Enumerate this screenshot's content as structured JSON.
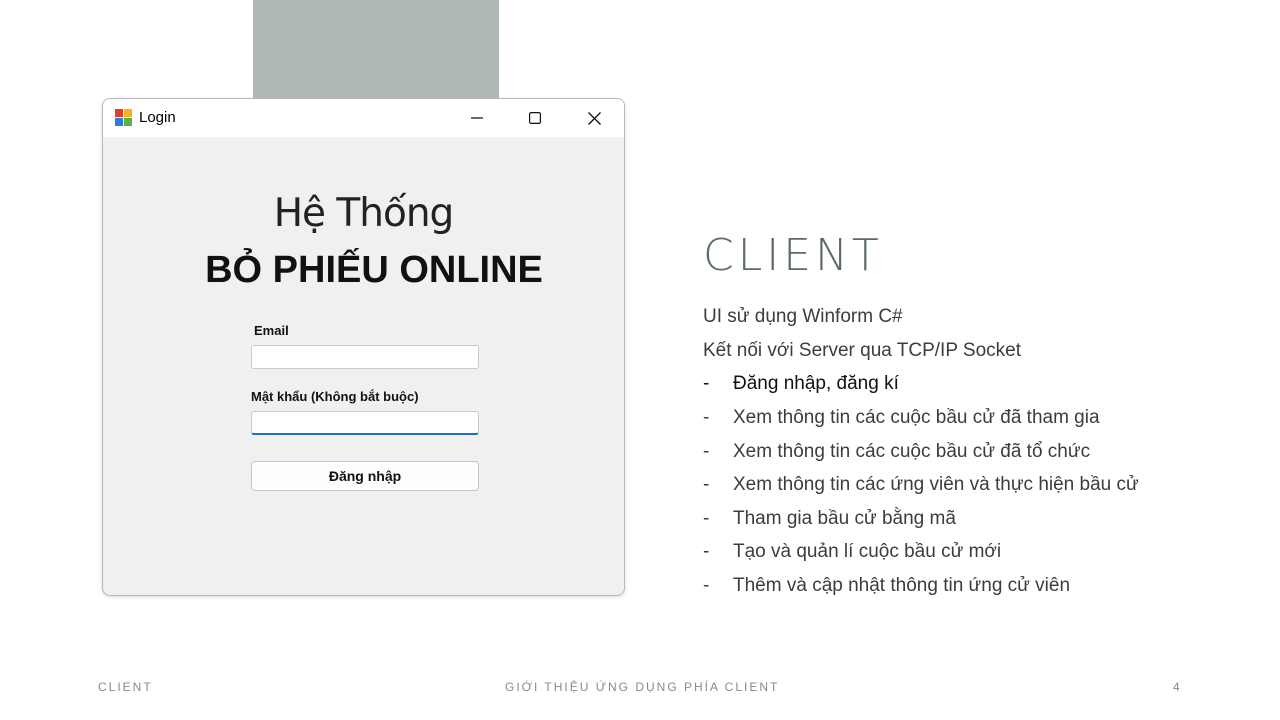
{
  "window": {
    "title": "Login",
    "heading_line1": "Hệ Thống",
    "heading_line2": "BỎ PHIẾU ONLINE",
    "email_label": "Email",
    "email_value": "",
    "password_label": "Mật khẩu (Không bắt buộc)",
    "password_value": "",
    "login_button": "Đăng nhập"
  },
  "slide": {
    "heading": "CLIENT",
    "lines": [
      "UI sử dụng Winform C#",
      "Kết nối với Server qua TCP/IP Socket"
    ],
    "bullet_marker": "-",
    "bullets": [
      "Đăng nhập, đăng kí",
      "Xem thông tin các cuộc bầu cử đã tham gia",
      "Xem thông tin các cuộc bầu cử đã tổ chức",
      "Xem thông tin các ứng viên và thực hiện bầu cử",
      "Tham gia bầu cử bằng mã",
      "Tạo và quản lí cuộc bầu cử mới",
      "Thêm và cập nhật thông tin ứng cử viên"
    ]
  },
  "footer": {
    "left": "CLIENT",
    "center": "GIỚI THIỆU ỨNG DỤNG PHÍA CLIENT",
    "page_number": "4"
  },
  "colors": {
    "accent_rect": "#b0b8b7",
    "heading": "#5a6b6a",
    "input_focus": "#1a6fc4"
  }
}
